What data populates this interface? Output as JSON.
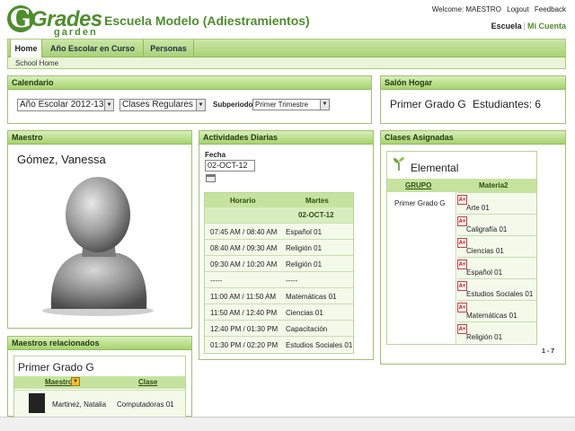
{
  "header": {
    "logo_text_main": "Grades",
    "logo_text_sub": "garden",
    "school_name": "Escuela Modelo (Adiestramientos)",
    "welcome": "Welcome: MAESTRO",
    "logout": "Logout",
    "feedback": "Feedback",
    "link_school": "Escuela",
    "link_account": "Mi Cuenta"
  },
  "nav": {
    "tabs": [
      {
        "label": "Home"
      },
      {
        "label": "Año Escolar en Curso"
      },
      {
        "label": "Personas"
      }
    ],
    "subnav": "School Home"
  },
  "calendario": {
    "title": "Calendario",
    "year_value": "Año Escolar 2012-13",
    "period_value": "Clases Regulares",
    "subperiod_label": "Subperiodo",
    "subperiod_value": "Primer Trimestre"
  },
  "salon": {
    "title": "Salón Hogar",
    "group": "Primer Grado G",
    "students": "Estudiantes: 6"
  },
  "maestro": {
    "title": "Maestro",
    "name": "Gómez, Vanessa"
  },
  "relacionados": {
    "title": "Maestros relacionados",
    "group": "Primer Grado G",
    "col_teacher": "Maestro",
    "col_class": "Clase",
    "rows": [
      {
        "teacher": "Martinez, Natalia",
        "class": "Computadoras 01"
      }
    ]
  },
  "actividades": {
    "title": "Actividades Diarias",
    "date_label": "Fecha",
    "date_value": "02-OCT-12",
    "col_time": "Horario",
    "col_day": "Martes",
    "day_date": "02-OCT-12",
    "rows": [
      {
        "time": "07:45 AM / 08:40 AM",
        "subject": "Español 01"
      },
      {
        "time": "08:40 AM / 09:30 AM",
        "subject": "Religión 01"
      },
      {
        "time": "09:30 AM / 10:20 AM",
        "subject": "Religión 01"
      },
      {
        "time": "-----",
        "subject": "-----"
      },
      {
        "time": "11:00 AM / 11:50 AM",
        "subject": "Matemáticas 01"
      },
      {
        "time": "11:50 AM / 12:40 PM",
        "subject": "Ciencias 01"
      },
      {
        "time": "12:40 PM / 01:30 PM",
        "subject": "Capacitación"
      },
      {
        "time": "01:30 PM / 02:20 PM",
        "subject": "Estudios Sociales 01"
      }
    ]
  },
  "clases": {
    "title": "Clases Asignadas",
    "level": "Elemental",
    "col_group": "GRUPO",
    "col_subject": "Materia2",
    "group": "Primer Grado G",
    "icon_text": "A+",
    "subjects": [
      "Arte 01",
      "Caligrafía 01",
      "Ciencias 01",
      "Español 01",
      "Estudios Sociales 01",
      "Matemáticas 01",
      "Religión 01"
    ],
    "pager": "1 - 7"
  },
  "colors": {
    "brand_green": "#4f8d2e",
    "panel_header": "#a6d36e"
  }
}
